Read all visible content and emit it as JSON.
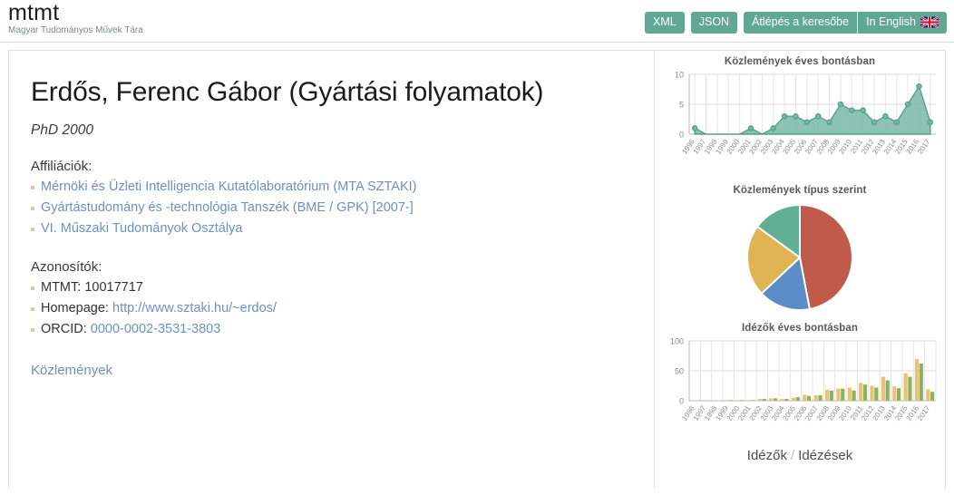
{
  "header": {
    "brand_title": "mtmt",
    "brand_subtitle": "Magyar Tudományos Művek Tára",
    "buttons": [
      {
        "id": "xml",
        "label": "XML"
      },
      {
        "id": "json",
        "label": "JSON"
      },
      {
        "id": "search",
        "label": "Átlépés a keresőbe"
      },
      {
        "id": "lang",
        "label": "In English",
        "icon": "uk-flag-icon"
      }
    ]
  },
  "profile": {
    "name": "Erdős, Ferenc Gábor (Gyártási folyamatok)",
    "degree": "PhD 2000",
    "affiliations_label": "Affiliációk:",
    "affiliations": [
      "Mérnöki és Üzleti Intelligencia Kutatólaboratórium (MTA SZTAKI)",
      "Gyártástudomány és -technológia Tanszék (BME / GPK) [2007-]",
      "VI. Műszaki Tudományok Osztálya"
    ],
    "identifiers_label": "Azonosítók:",
    "identifiers": [
      {
        "label": "MTMT:",
        "value": "10017717",
        "is_link": false
      },
      {
        "label": "Homepage:",
        "value": "http://www.sztaki.hu/~erdos/",
        "is_link": true
      },
      {
        "label": "ORCID:",
        "value": "0000-0002-3531-3803",
        "is_link": true
      }
    ],
    "publications_link": "Közlemények"
  },
  "right_panel": {
    "footer": {
      "citers_label": "Idézők",
      "separator": "/",
      "citations_label": "Idézések"
    }
  },
  "colors": {
    "accent_green": "#60a894",
    "area_fill": "#79b8a4",
    "area_line": "#55a08a",
    "pie_red": "#c05a4b",
    "pie_blue": "#5a8cc6",
    "pie_yellow": "#e0b452",
    "pie_green": "#61b096",
    "bar_tan": "#e8c377",
    "bar_green": "#8cb35c",
    "link_blue": "#6f8fc4",
    "bullet": "#cfcfa9"
  },
  "chart_data": [
    {
      "id": "publications-per-year",
      "type": "area",
      "title": "Közlemények éves bontásban",
      "xlabel": "",
      "ylabel": "",
      "ylim": [
        0,
        10
      ],
      "yticks": [
        0,
        5,
        10
      ],
      "grid": true,
      "categories": [
        "1996",
        "1997",
        "1998",
        "1999",
        "2000",
        "2001",
        "2002",
        "2003",
        "2004",
        "2005",
        "2006",
        "2007",
        "2008",
        "2009",
        "2010",
        "2011",
        "2012",
        "2013",
        "2014",
        "2015",
        "2016",
        "2017"
      ],
      "values": [
        1,
        0,
        0,
        0,
        0,
        1,
        0,
        1,
        3,
        3,
        2,
        3,
        2,
        5,
        4,
        4,
        2,
        3,
        2,
        5,
        8,
        2
      ]
    },
    {
      "id": "publications-by-type",
      "type": "pie",
      "title": "Közlemények típus szerint",
      "legend": "none",
      "slices": [
        {
          "name": "slice-1",
          "value": 47,
          "color": "#c05a4b"
        },
        {
          "name": "slice-2",
          "value": 16,
          "color": "#5a8cc6"
        },
        {
          "name": "slice-3",
          "value": 22,
          "color": "#e0b452"
        },
        {
          "name": "slice-4",
          "value": 15,
          "color": "#61b096"
        }
      ]
    },
    {
      "id": "citers-per-year",
      "type": "bar",
      "title": "Idézők éves bontásban",
      "xlabel": "",
      "ylabel": "",
      "ylim": [
        0,
        100
      ],
      "yticks": [
        0,
        50,
        100
      ],
      "grid": true,
      "categories": [
        "1996",
        "1997",
        "1998",
        "1999",
        "2000",
        "2001",
        "2002",
        "2003",
        "2004",
        "2005",
        "2006",
        "2007",
        "2008",
        "2009",
        "2010",
        "2011",
        "2012",
        "2013",
        "2014",
        "2015",
        "2016",
        "2017"
      ],
      "series": [
        {
          "name": "idézők",
          "color": "#e8c377",
          "values": [
            0,
            0,
            0,
            1,
            1,
            1,
            3,
            4,
            3,
            5,
            10,
            9,
            18,
            20,
            22,
            30,
            25,
            40,
            24,
            46,
            70,
            19
          ]
        },
        {
          "name": "idézések",
          "color": "#8cb35c",
          "values": [
            0,
            0,
            0,
            1,
            1,
            1,
            3,
            4,
            3,
            6,
            8,
            9,
            17,
            20,
            17,
            27,
            22,
            34,
            21,
            40,
            62,
            15
          ]
        }
      ]
    }
  ]
}
